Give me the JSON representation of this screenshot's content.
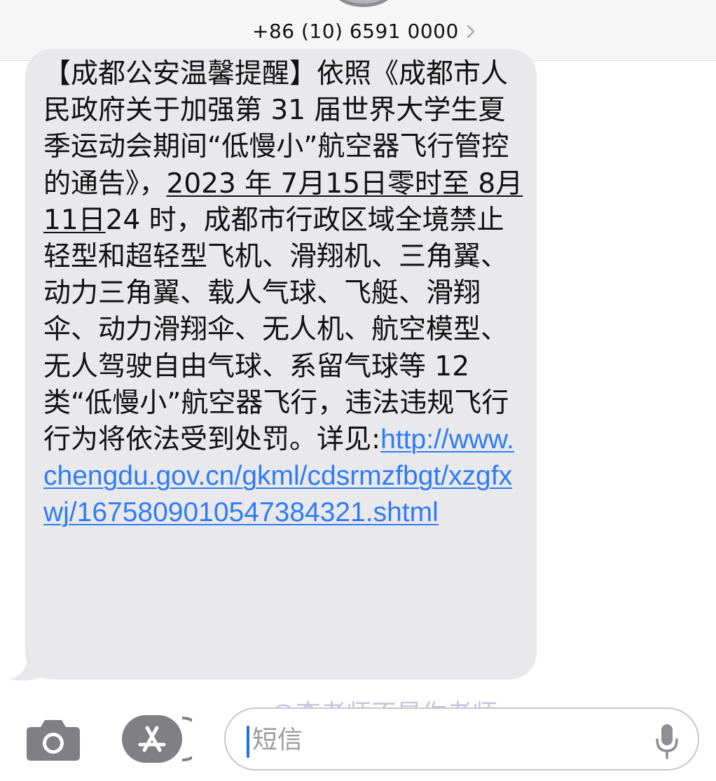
{
  "header": {
    "contact_number": "+86 (10) 6591 0000",
    "chevron_icon": "chevron-right-icon"
  },
  "message": {
    "segment_1": "【成都公安温馨提醒】依照《成都市人民政府关于加强第 31 届世界大学生夏季运动会期间“低慢小”航空器飞行管控的通告》，",
    "date_text": "2023 年 7月15日零时至 8月11日",
    "segment_2": "24 时，成都市行政区域全境禁止轻型和超轻型飞机、滑翔机、三角翼、动力三角翼、载人气球、飞艇、滑翔伞、动力滑翔伞、无人机、航空模型、无人驾驶自由气球、系留气球等 12 类“低慢小”航空器飞行，违法违规飞行行为将依法受到处罚。详见:",
    "link": "http://www.chengdu.gov.cn/gkml/cdsrmzfbgt/xzgfxwj/1675809010547384321.shtml"
  },
  "watermark": "@李老师不是你老师",
  "input": {
    "placeholder": "短信"
  },
  "colors": {
    "bubble": "#e9e9eb",
    "link": "#2f7cf6",
    "header_bg": "#f6f6f6",
    "icon_gray": "#8e8e93",
    "cursor": "#1f6fe0"
  },
  "icons": [
    "camera-icon",
    "app-store-icon",
    "microphone-icon",
    "chevron-right-icon"
  ]
}
